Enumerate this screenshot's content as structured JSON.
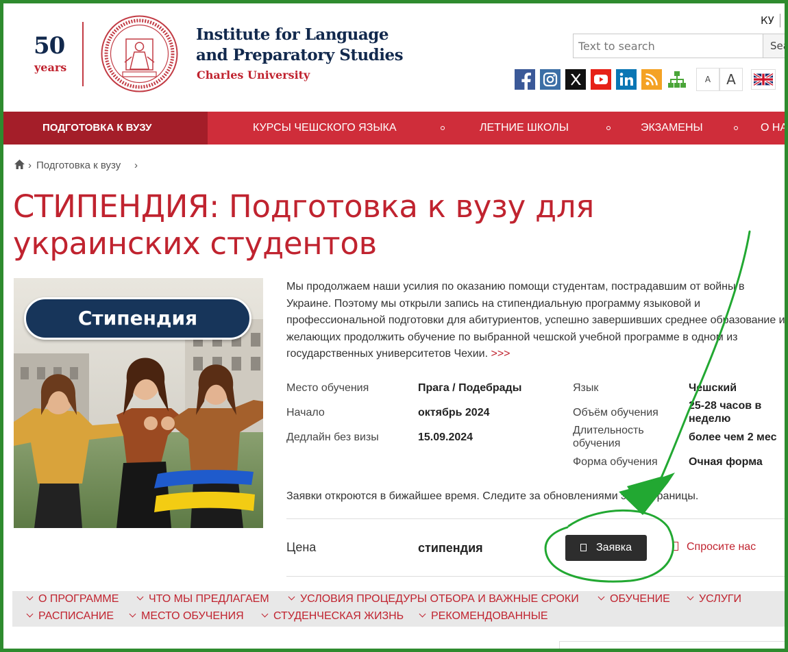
{
  "header": {
    "anniversary_number": "50",
    "anniversary_label": "years",
    "institute_line1": "Institute for Language",
    "institute_line2": "and Preparatory Studies",
    "university": "Charles University",
    "language_switch": "КУ",
    "search_placeholder": "Text to search",
    "search_button": "Sea",
    "font_small": "A",
    "font_large": "A",
    "social_icons": [
      "facebook-icon",
      "instagram-icon",
      "x-icon",
      "youtube-icon",
      "linkedin-icon",
      "rss-icon",
      "sitemap-icon"
    ]
  },
  "nav": {
    "items": [
      "ПОДГОТОВКА К ВУЗУ",
      "КУРСЫ ЧЕШСКОГО ЯЗЫКА",
      "ЛЕТНИЕ ШКОЛЫ",
      "ЭКЗАМЕНЫ",
      "О НА"
    ]
  },
  "breadcrumb": {
    "current": "Подготовка к вузу",
    "separator": "›"
  },
  "page": {
    "title": "СТИПЕНДИЯ: Подготовка к вузу для украинских студентов",
    "image_badge": "Стипендия",
    "intro": "Мы продолжаем наши усилия по оказанию помощи студентам, пострадавшим от войны в Украине. Поэтому мы открыли запись на стипендиальную программу языковой и профессиональной подготовки для абитуриентов, успешно завершивших среднее образование и желающих продолжить обучение по выбранной чешской учебной программе в одном из государственных университетов Чехии.",
    "more_link": ">>>"
  },
  "details": {
    "place_label": "Место обучения",
    "place_value": "Прага / Подебрады",
    "start_label": "Начало",
    "start_value": "октябрь 2024",
    "deadline_label": "Дедлайн без визы",
    "deadline_value": "15.09.2024",
    "language_label": "Язык",
    "language_value": "Чешский",
    "volume_label": "Объём обучения",
    "volume_value_1": "25-28 часов в",
    "volume_value_2": "неделю",
    "duration_label_1": "Длительность",
    "duration_label_2": "обучения",
    "duration_value": "более чем 2 мес",
    "form_label": "Форма обучения",
    "form_value": "Очная форма"
  },
  "notice": "Заявки откроются в бижайшее время. Следите за обновлениями этой страницы.",
  "pricing": {
    "label": "Цена",
    "value": "стипендия",
    "apply_button": "Заявка",
    "ask_link": "Спросите нас"
  },
  "sections": {
    "row1": [
      "О ПРОГРАММЕ",
      "ЧТО МЫ ПРЕДЛАГАЕМ",
      "УСЛОВИЯ ПРОЦЕДУРЫ ОТБОРА И ВАЖНЫЕ СРОКИ",
      "ОБУЧЕНИЕ",
      "УСЛУГИ"
    ],
    "row2": [
      "РАСПИСАНИЕ",
      "МЕСТО ОБУЧЕНИЯ",
      "СТУДЕНЧЕСКАЯ ЖИЗНЬ",
      "РЕКОМЕНДОВАННЫЕ"
    ]
  },
  "colors": {
    "brand_red": "#cf2d3a",
    "brand_navy": "#12294d",
    "annotation_green": "#22a832"
  }
}
